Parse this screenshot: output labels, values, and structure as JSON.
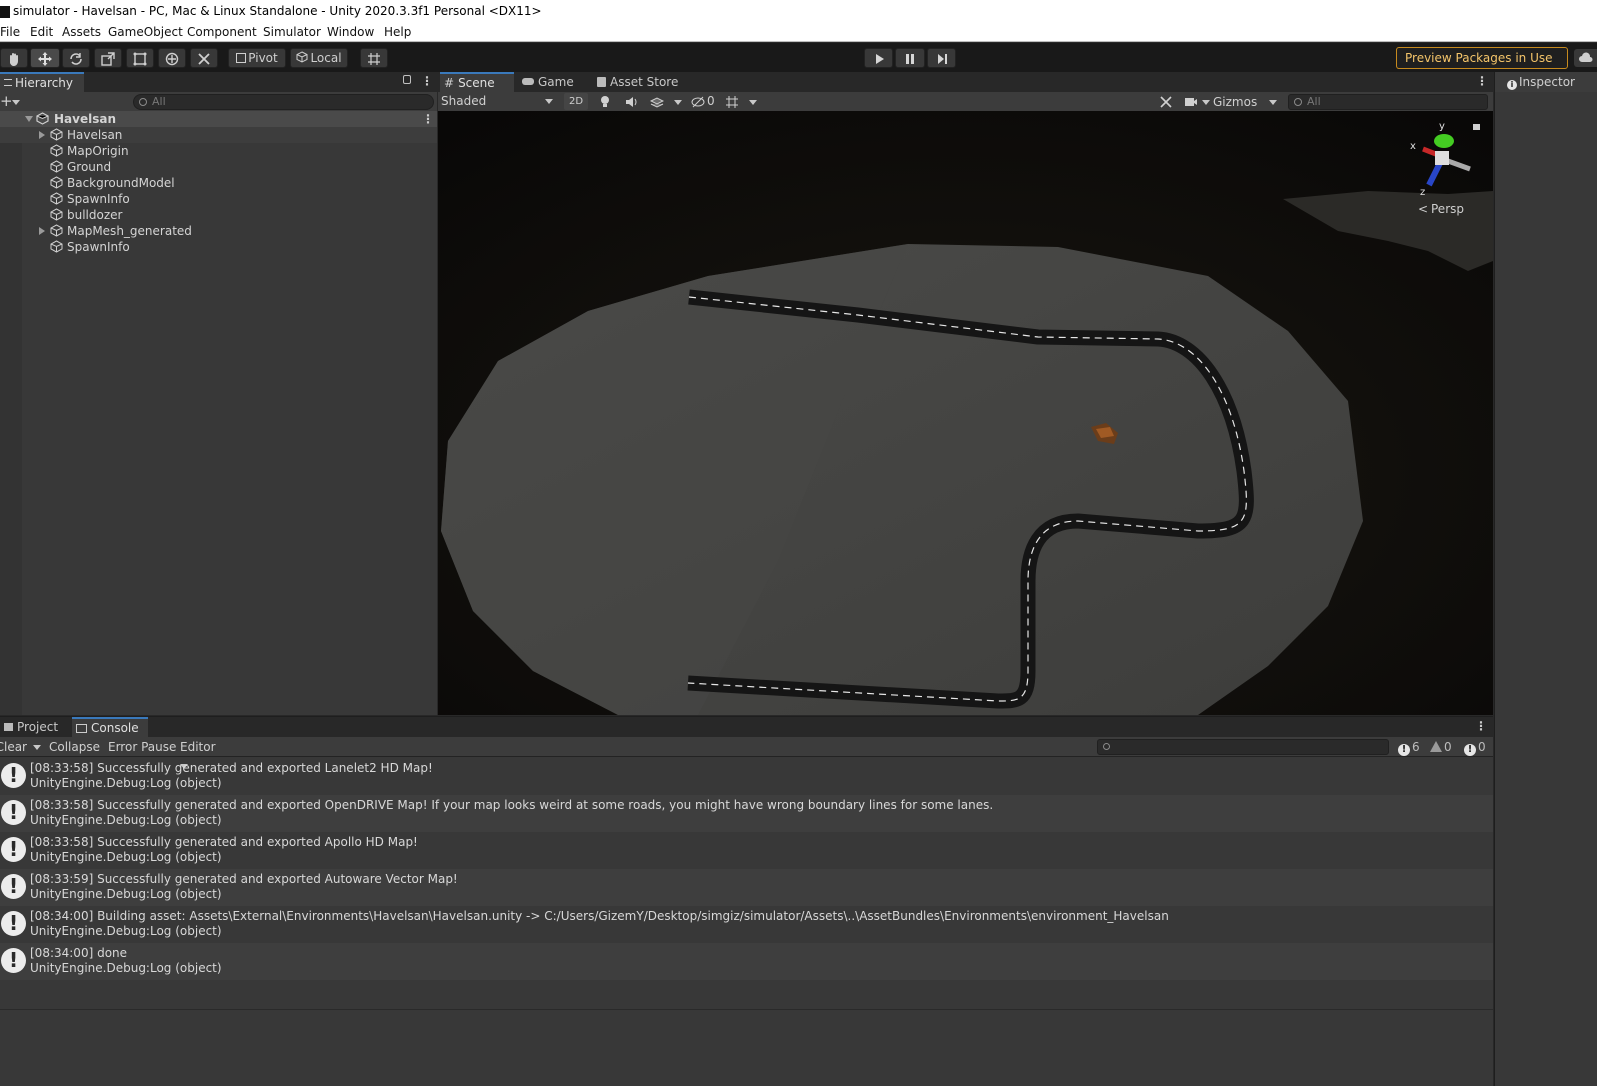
{
  "window": {
    "title": "simulator - Havelsan - PC, Mac & Linux Standalone - Unity 2020.3.3f1 Personal <DX11>"
  },
  "menu": [
    "File",
    "Edit",
    "Assets",
    "GameObject",
    "Component",
    "Simulator",
    "Window",
    "Help"
  ],
  "toolbar": {
    "pivot_label": "Pivot",
    "local_label": "Local",
    "preview_packages_label": "Preview Packages in Use"
  },
  "hierarchy": {
    "tab_label": "Hierarchy",
    "search_placeholder": "All",
    "scene_name": "Havelsan",
    "items": [
      {
        "label": "Havelsan",
        "expandable": true
      },
      {
        "label": "MapOrigin",
        "expandable": false
      },
      {
        "label": "Ground",
        "expandable": false
      },
      {
        "label": "BackgroundModel",
        "expandable": false
      },
      {
        "label": "SpawnInfo",
        "expandable": false
      },
      {
        "label": "bulldozer",
        "expandable": false
      },
      {
        "label": "MapMesh_generated",
        "expandable": true
      },
      {
        "label": "SpawnInfo",
        "expandable": false
      }
    ]
  },
  "scene": {
    "tabs": [
      "Scene",
      "Game",
      "Asset Store"
    ],
    "shading_mode": "Shaded",
    "mode_2d_label": "2D",
    "hidden_count": "0",
    "gizmos_label": "Gizmos",
    "search_placeholder": "All",
    "gizmo_axes": {
      "x": "x",
      "y": "y",
      "z": "z"
    },
    "projection_label": "Persp",
    "colors": {
      "ground": "#4a4a4a",
      "road": "#111111",
      "lane_marking": "#e8e8e8",
      "sky": "#0b0b0b"
    }
  },
  "inspector": {
    "tab_label": "Inspector"
  },
  "console": {
    "tabs": [
      "Project",
      "Console"
    ],
    "buttons": {
      "clear": "Clear",
      "collapse": "Collapse",
      "error_pause": "Error Pause",
      "editor": "Editor"
    },
    "counts": {
      "log": "6",
      "warning": "0",
      "error": "0"
    },
    "entries": [
      {
        "message": "[08:33:58] Successfully generated and exported Lanelet2 HD Map!",
        "source": "UnityEngine.Debug:Log (object)"
      },
      {
        "message": "[08:33:58] Successfully generated and exported OpenDRIVE Map! If your map looks weird at some roads, you might have wrong boundary lines for some lanes.",
        "source": "UnityEngine.Debug:Log (object)"
      },
      {
        "message": "[08:33:58] Successfully generated and exported Apollo HD Map!",
        "source": "UnityEngine.Debug:Log (object)"
      },
      {
        "message": "[08:33:59] Successfully generated and exported Autoware Vector Map!",
        "source": "UnityEngine.Debug:Log (object)"
      },
      {
        "message": "[08:34:00] Building asset: Assets\\External\\Environments\\Havelsan\\Havelsan.unity -> C:/Users/GizemY/Desktop/simgiz/simulator/Assets\\..\\AssetBundles\\Environments\\environment_Havelsan",
        "source": "UnityEngine.Debug:Log (object)"
      },
      {
        "message": "[08:34:00] done",
        "source": "UnityEngine.Debug:Log (object)"
      }
    ]
  }
}
